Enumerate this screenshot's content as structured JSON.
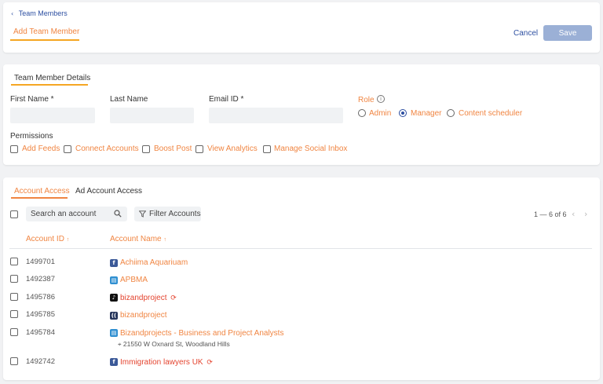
{
  "header": {
    "breadcrumb": "Team Members",
    "page_title": "Add Team Member",
    "cancel_label": "Cancel",
    "save_label": "Save"
  },
  "details": {
    "section_title": "Team Member Details",
    "first_name_label": "First Name *",
    "last_name_label": "Last Name",
    "email_label": "Email ID *",
    "role_label": "Role",
    "roles": [
      {
        "label": "Admin",
        "selected": false
      },
      {
        "label": "Manager",
        "selected": true
      },
      {
        "label": "Content scheduler",
        "selected": false
      }
    ],
    "permissions_label": "Permissions",
    "permissions": [
      "Add Feeds",
      "Connect Accounts",
      "Boost Post",
      "View Analytics",
      "Manage Social Inbox"
    ]
  },
  "access": {
    "tabs": [
      {
        "label": "Account Access",
        "active": true
      },
      {
        "label": "Ad Account Access",
        "active": false
      }
    ],
    "search_placeholder": "Search an account",
    "filter_label": "Filter Accounts",
    "pagination": "1 — 6 of 6",
    "col_id": "Account ID",
    "col_name": "Account Name",
    "rows": [
      {
        "id": "1499701",
        "name": "Achiima Aquariuam",
        "platform": "facebook",
        "error": false
      },
      {
        "id": "1492387",
        "name": "APBMA",
        "platform": "google-business",
        "error": false
      },
      {
        "id": "1495786",
        "name": "bizandproject",
        "platform": "tiktok",
        "error": true
      },
      {
        "id": "1495785",
        "name": "bizandproject",
        "platform": "linkedin",
        "error": false
      },
      {
        "id": "1495784",
        "name": "Bizandprojects - Business and Project Analysts",
        "platform": "google-business",
        "error": false,
        "address": "21550 W Oxnard St, Woodland Hills"
      },
      {
        "id": "1492742",
        "name": "Immigration lawyers UK",
        "platform": "facebook",
        "error": true
      }
    ]
  },
  "colors": {
    "accent_orange": "#f08542",
    "underline_yellow": "#f5a623",
    "brand_blue": "#2d4fa1",
    "error_red": "#e4442f",
    "save_disabled": "#9bb0d6"
  }
}
